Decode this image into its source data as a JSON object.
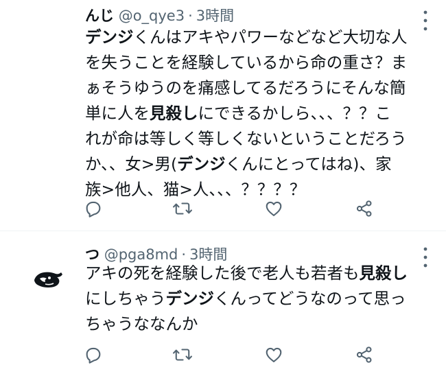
{
  "tweets": [
    {
      "name": "んじ",
      "handle": "@o_qye3",
      "separator": "·",
      "time": "3時間",
      "lines": [
        [
          {
            "t": "デンジ",
            "b": true
          },
          {
            "t": "くんはアキやパワーなどなど大切な人"
          }
        ],
        [
          {
            "t": "を失うことを経験しているから命の重さ？ま"
          }
        ],
        [
          {
            "t": "ぁそうゆうのを痛感してるだろうにそんな簡"
          }
        ],
        [
          {
            "t": "単に人を"
          },
          {
            "t": "見殺し",
            "b": true
          },
          {
            "t": "にできるかしら、、、？？こ"
          }
        ],
        [
          {
            "t": "れが命は等しく等しくないということだろう"
          }
        ],
        [
          {
            "t": "か、、女>男("
          },
          {
            "t": "デンジ",
            "b": true
          },
          {
            "t": "くんにとってはね)、家"
          }
        ],
        [
          {
            "t": "族>他人、猫>人、、、？？？？"
          }
        ]
      ],
      "icons": {
        "more": "more-dots-icon",
        "reply": "reply-icon",
        "retweet": "retweet-icon",
        "like": "heart-icon",
        "share": "share-icon"
      }
    },
    {
      "name": "つ",
      "handle": "@pga8md",
      "separator": "·",
      "time": "3時間",
      "lines": [
        [
          {
            "t": "アキの死を経験した後で老人も若者も"
          },
          {
            "t": "見殺し",
            "b": true
          }
        ],
        [
          {
            "t": "にしちゃう"
          },
          {
            "t": "デンジ",
            "b": true
          },
          {
            "t": "くんってどうなのって思っ"
          }
        ],
        [
          {
            "t": "ちゃうななんか"
          }
        ]
      ],
      "icons": {
        "avatar": "avatar",
        "more": "more-dots-icon",
        "reply": "reply-icon",
        "retweet": "retweet-icon",
        "like": "heart-icon",
        "share": "share-icon"
      }
    }
  ],
  "colors": {
    "text": "#0f1419",
    "secondary": "#536471",
    "divider": "#eff3f4"
  }
}
